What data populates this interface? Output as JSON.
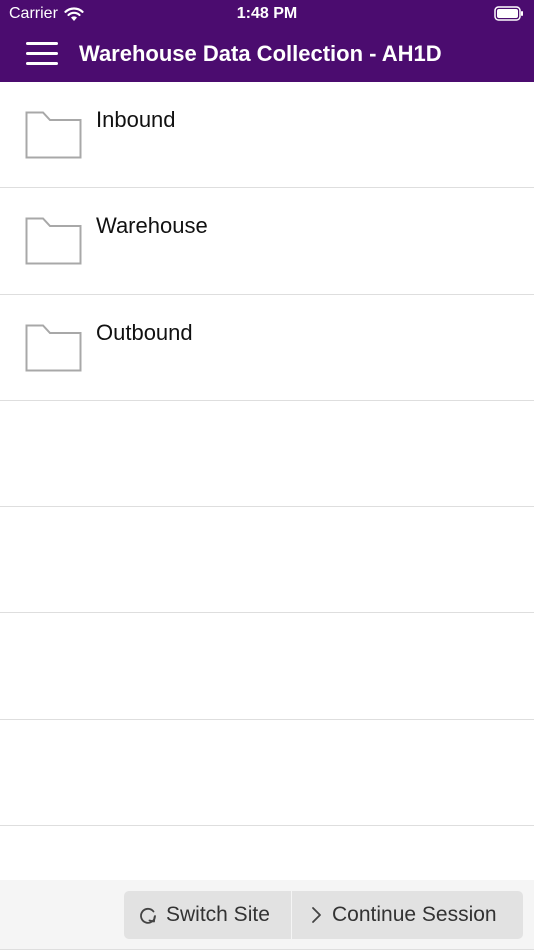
{
  "status_bar": {
    "carrier": "Carrier",
    "time": "1:48 PM",
    "wifi_icon": "wifi-icon",
    "battery_icon": "battery-full-icon"
  },
  "app_bar": {
    "menu_icon": "hamburger-menu-icon",
    "title": "Warehouse Data Collection - AH1D",
    "background_color": "#4b0c6f"
  },
  "menu": {
    "items": [
      {
        "label": "Inbound",
        "icon": "folder-icon"
      },
      {
        "label": "Warehouse",
        "icon": "folder-icon"
      },
      {
        "label": "Outbound",
        "icon": "folder-icon"
      }
    ]
  },
  "bottom_bar": {
    "switch_site": {
      "label": "Switch Site",
      "icon": "refresh-icon"
    },
    "continue_session": {
      "label": "Continue Session",
      "icon": "chevron-right-icon"
    }
  }
}
